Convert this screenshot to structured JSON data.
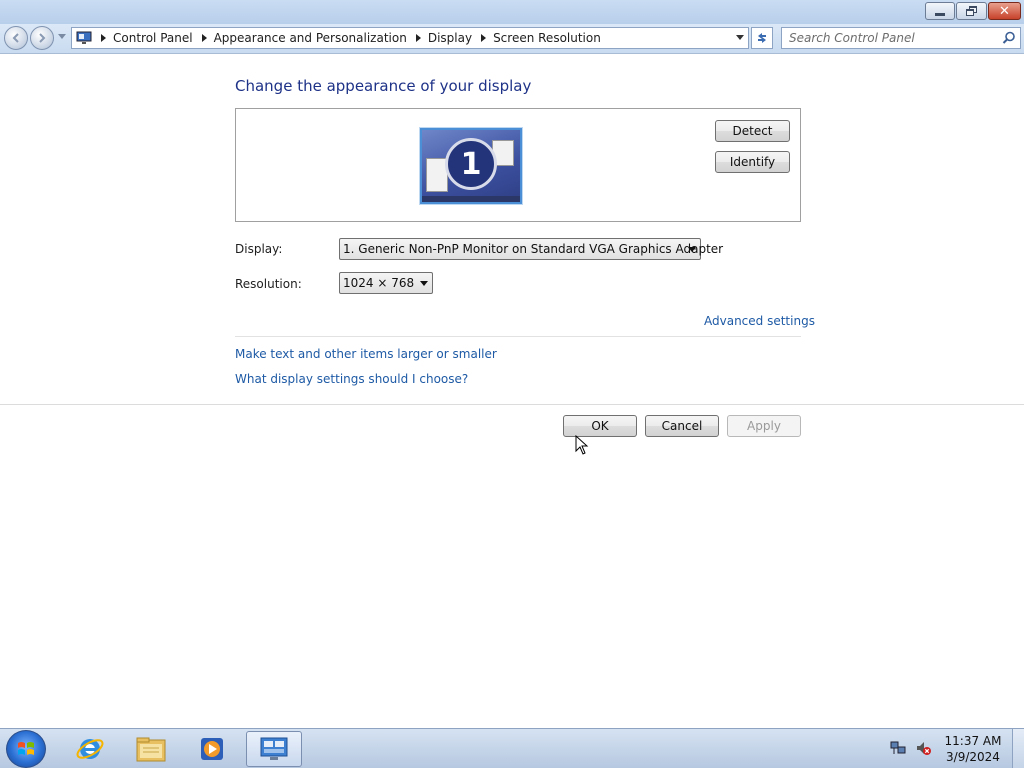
{
  "window": {
    "controls": {
      "minimize_icon": "minimize-icon",
      "maximize_icon": "restore-icon",
      "close_icon": "close-icon",
      "close_glyph": "✕"
    }
  },
  "nav": {
    "breadcrumbs": [
      "Control Panel",
      "Appearance and Personalization",
      "Display",
      "Screen Resolution"
    ],
    "search_placeholder": "Search Control Panel"
  },
  "main": {
    "heading": "Change the appearance of your display",
    "monitor_number": "1",
    "detect_label": "Detect",
    "identify_label": "Identify",
    "display_label": "Display:",
    "display_value": "1. Generic Non-PnP Monitor on Standard VGA Graphics Adapter",
    "resolution_label": "Resolution:",
    "resolution_value": "1024 × 768",
    "advanced_link": "Advanced settings",
    "text_size_link": "Make text and other items larger or smaller",
    "help_link": "What display settings should I choose?"
  },
  "footer": {
    "ok_label": "OK",
    "cancel_label": "Cancel",
    "apply_label": "Apply"
  },
  "taskbar": {
    "time": "11:37 AM",
    "date": "3/9/2024",
    "pinned": [
      "internet-explorer-icon",
      "windows-explorer-icon",
      "media-player-icon",
      "control-panel-icon"
    ]
  },
  "colors": {
    "heading": "#1e3287",
    "link": "#1e5aa5",
    "taskbar": "#c9d8ec"
  }
}
